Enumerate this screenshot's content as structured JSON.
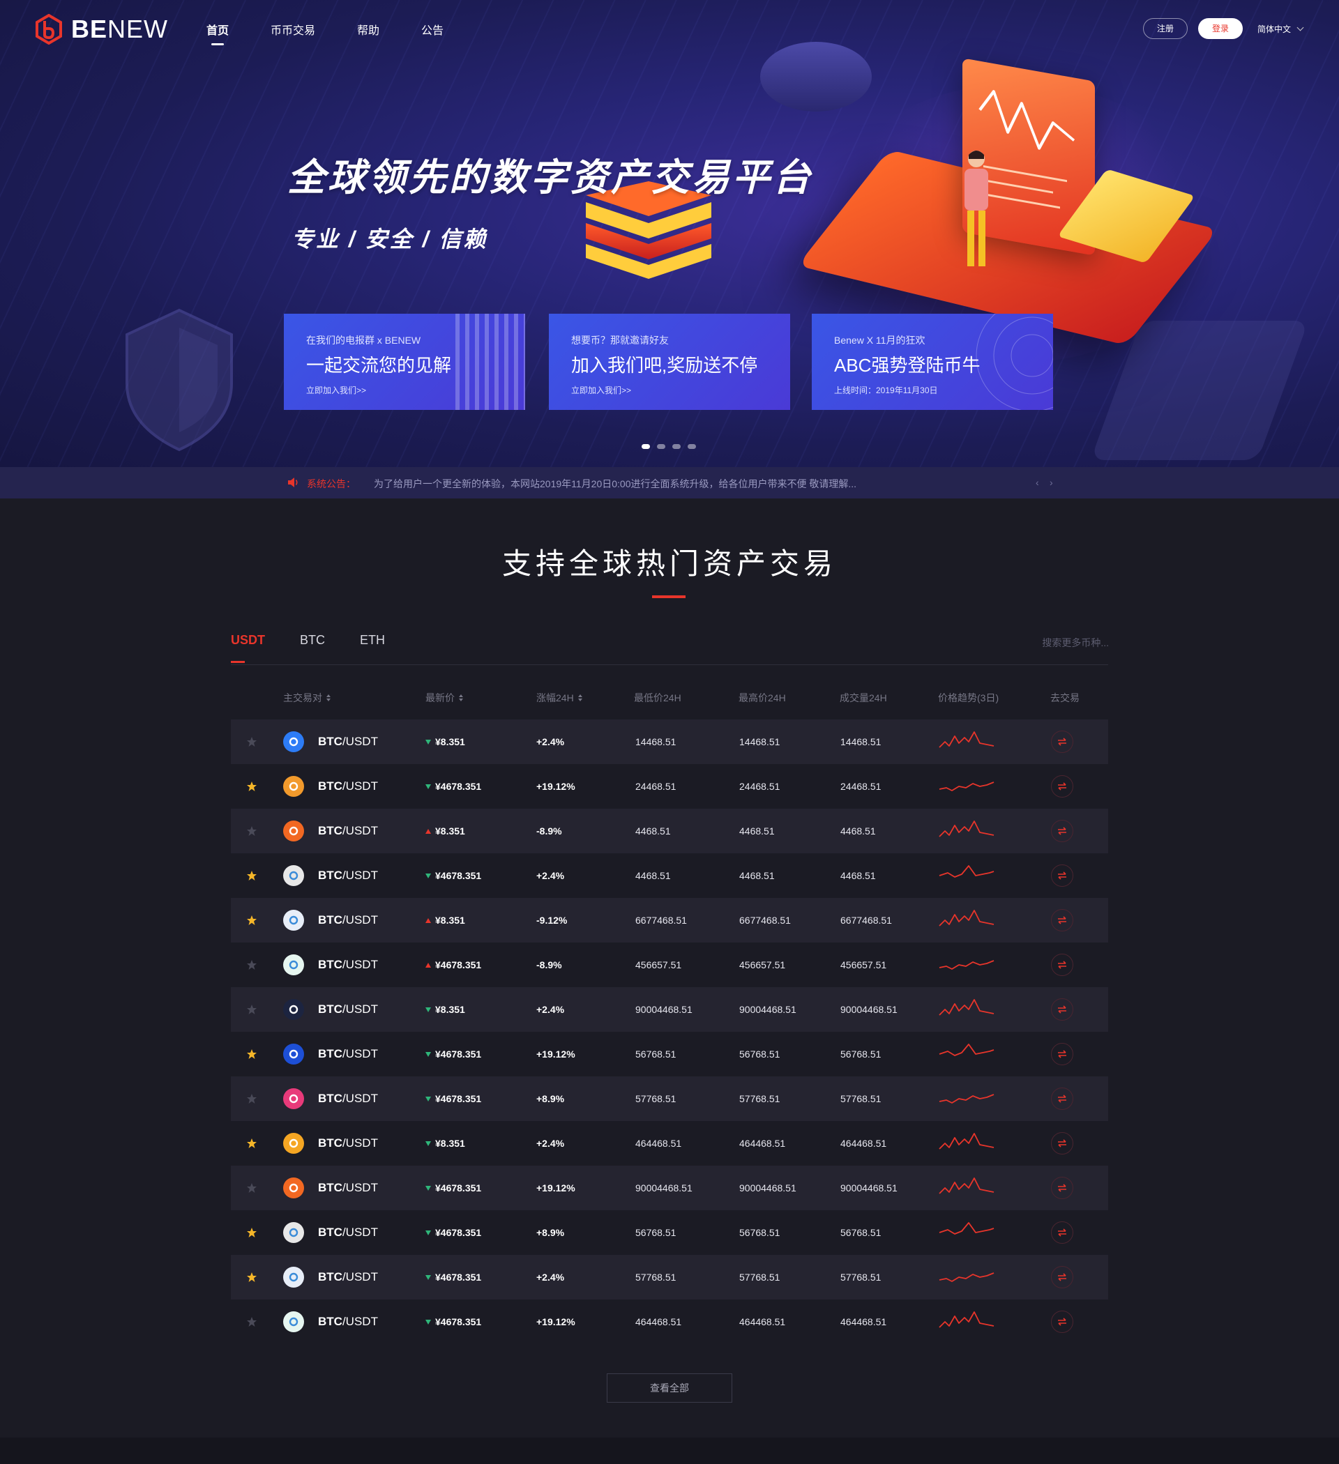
{
  "brand": {
    "name_bold": "BE",
    "name_rest": "NEW"
  },
  "nav": {
    "items": [
      {
        "label": "首页",
        "active": true
      },
      {
        "label": "币币交易",
        "active": false
      },
      {
        "label": "帮助",
        "active": false
      },
      {
        "label": "公告",
        "active": false
      }
    ],
    "register": "注册",
    "login": "登录",
    "language": "简体中文"
  },
  "hero": {
    "title": "全球领先的数字资产交易平台",
    "subtitle": "专业 / 安全 / 信赖"
  },
  "promos": [
    {
      "line1": "在我们的电报群 x BENEW",
      "line2": "一起交流您的见解",
      "line3": "立即加入我们>>"
    },
    {
      "line1": "想要币？那就邀请好友",
      "line2": "加入我们吧,奖励送不停",
      "line3": "立即加入我们>>"
    },
    {
      "line1": "Benew X 11月的狂欢",
      "line2": "ABC强势登陆币牛",
      "line3": "上线时间：2019年11月30日"
    }
  ],
  "carousel": {
    "total": 4,
    "active_index": 0
  },
  "notice": {
    "label": "系统公告：",
    "text": "为了给用户一个更全新的体验，本网站2019年11月20日0:00进行全面系统升级，给各位用户带来不便 敬请理解...",
    "prev": "‹",
    "next": "›"
  },
  "market": {
    "title": "支持全球热门资产交易",
    "tabs": [
      {
        "label": "USDT",
        "active": true
      },
      {
        "label": "BTC",
        "active": false
      },
      {
        "label": "ETH",
        "active": false
      }
    ],
    "search_placeholder": "搜索更多币种...",
    "columns": {
      "pair": "主交易对",
      "price": "最新价",
      "change": "涨幅24H",
      "low": "最低价24H",
      "high": "最高价24H",
      "volume": "成交量24H",
      "trend": "价格趋势(3日)",
      "trade": "去交易"
    },
    "rows": [
      {
        "fav": false,
        "coin_icon": "chain-link-icon",
        "coin_color": "#2d7cf6",
        "base": "BTC",
        "quote": "/USDT",
        "dir": "down",
        "price": "¥8.351",
        "change": "+2.4%",
        "low": "14468.51",
        "high": "14468.51",
        "volume": "14468.51",
        "trend": "a"
      },
      {
        "fav": true,
        "coin_icon": "bitcoin-icon",
        "coin_color": "#f29a2c",
        "base": "BTC",
        "quote": "/USDT",
        "dir": "down",
        "price": "¥4678.351",
        "change": "+19.12%",
        "low": "24468.51",
        "high": "24468.51",
        "volume": "24468.51",
        "trend": "b"
      },
      {
        "fav": false,
        "coin_icon": "monero-icon",
        "coin_color": "#f26822",
        "base": "BTC",
        "quote": "/USDT",
        "dir": "up",
        "price": "¥8.351",
        "change": "-8.9%",
        "low": "4468.51",
        "high": "4468.51",
        "volume": "4468.51",
        "trend": "a"
      },
      {
        "fav": true,
        "coin_icon": "nem-icon",
        "coin_color": "#e8e8e8",
        "base": "BTC",
        "quote": "/USDT",
        "dir": "down",
        "price": "¥4678.351",
        "change": "+2.4%",
        "low": "4468.51",
        "high": "4468.51",
        "volume": "4468.51",
        "trend": "c"
      },
      {
        "fav": true,
        "coin_icon": "telegram-icon",
        "coin_color": "#e8eef8",
        "base": "BTC",
        "quote": "/USDT",
        "dir": "up",
        "price": "¥8.351",
        "change": "-9.12%",
        "low": "6677468.51",
        "high": "6677468.51",
        "volume": "6677468.51",
        "trend": "a"
      },
      {
        "fav": false,
        "coin_icon": "clover-icon",
        "coin_color": "#e6f6f0",
        "base": "BTC",
        "quote": "/USDT",
        "dir": "up",
        "price": "¥4678.351",
        "change": "-8.9%",
        "low": "456657.51",
        "high": "456657.51",
        "volume": "456657.51",
        "trend": "b"
      },
      {
        "fav": false,
        "coin_icon": "hexagon-icon",
        "coin_color": "#1c2440",
        "base": "BTC",
        "quote": "/USDT",
        "dir": "down",
        "price": "¥8.351",
        "change": "+2.4%",
        "low": "90004468.51",
        "high": "90004468.51",
        "volume": "90004468.51",
        "trend": "a"
      },
      {
        "fav": true,
        "coin_icon": "waves-w-icon",
        "coin_color": "#1d4fd6",
        "base": "BTC",
        "quote": "/USDT",
        "dir": "down",
        "price": "¥4678.351",
        "change": "+19.12%",
        "low": "56768.51",
        "high": "56768.51",
        "volume": "56768.51",
        "trend": "c"
      },
      {
        "fav": false,
        "coin_icon": "b-pink-icon",
        "coin_color": "#e83a7a",
        "base": "BTC",
        "quote": "/USDT",
        "dir": "down",
        "price": "¥4678.351",
        "change": "+8.9%",
        "low": "57768.51",
        "high": "57768.51",
        "volume": "57768.51",
        "trend": "b"
      },
      {
        "fav": true,
        "coin_icon": "orange-drop-icon",
        "coin_color": "#f5a623",
        "base": "BTC",
        "quote": "/USDT",
        "dir": "down",
        "price": "¥8.351",
        "change": "+2.4%",
        "low": "464468.51",
        "high": "464468.51",
        "volume": "464468.51",
        "trend": "a"
      },
      {
        "fav": false,
        "coin_icon": "monero-icon",
        "coin_color": "#f26822",
        "base": "BTC",
        "quote": "/USDT",
        "dir": "down",
        "price": "¥4678.351",
        "change": "+19.12%",
        "low": "90004468.51",
        "high": "90004468.51",
        "volume": "90004468.51",
        "trend": "a"
      },
      {
        "fav": true,
        "coin_icon": "nem-icon",
        "coin_color": "#e8e8e8",
        "base": "BTC",
        "quote": "/USDT",
        "dir": "down",
        "price": "¥4678.351",
        "change": "+8.9%",
        "low": "56768.51",
        "high": "56768.51",
        "volume": "56768.51",
        "trend": "c"
      },
      {
        "fav": true,
        "coin_icon": "telegram-icon",
        "coin_color": "#e8eef8",
        "base": "BTC",
        "quote": "/USDT",
        "dir": "down",
        "price": "¥4678.351",
        "change": "+2.4%",
        "low": "57768.51",
        "high": "57768.51",
        "volume": "57768.51",
        "trend": "b"
      },
      {
        "fav": false,
        "coin_icon": "clover-icon",
        "coin_color": "#e6f6f0",
        "base": "BTC",
        "quote": "/USDT",
        "dir": "down",
        "price": "¥4678.351",
        "change": "+19.12%",
        "low": "464468.51",
        "high": "464468.51",
        "volume": "464468.51",
        "trend": "a"
      }
    ],
    "view_all": "查看全部"
  },
  "colors": {
    "accent_red": "#e8352b",
    "green": "#2fb67a",
    "star_on": "#f5b629",
    "star_off": "#4a4a58"
  }
}
